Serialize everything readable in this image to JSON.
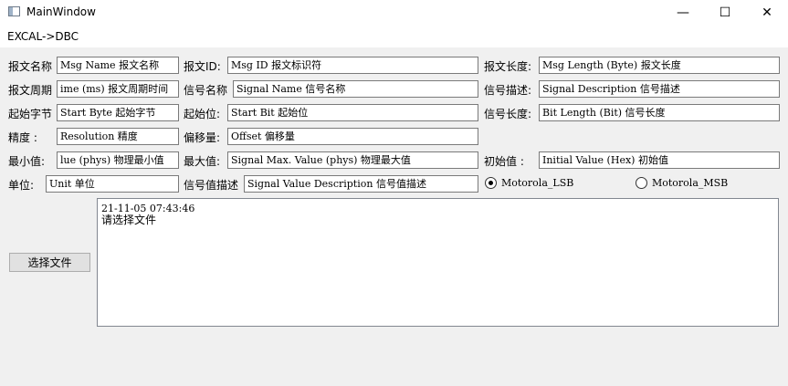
{
  "window": {
    "title": "MainWindow",
    "minimize": "—",
    "maximize": "☐",
    "close": "✕"
  },
  "menu": {
    "item": "EXCAL->DBC"
  },
  "rows": [
    [
      {
        "label": "报文名称",
        "value": "Msg Name 报文名称"
      },
      {
        "label": "报文ID:",
        "value": "Msg ID 报文标识符"
      },
      {
        "label": "报文长度:",
        "value": "Msg Length (Byte) 报文长度"
      }
    ],
    [
      {
        "label": "报文周期",
        "value": "ime (ms) 报文周期时间"
      },
      {
        "label": "信号名称",
        "value": "Signal Name 信号名称"
      },
      {
        "label": "信号描述:",
        "value": "Signal Description 信号描述"
      }
    ],
    [
      {
        "label": "起始字节",
        "value": "Start Byte 起始字节"
      },
      {
        "label": "起始位:",
        "value": "Start Bit 起始位"
      },
      {
        "label": "信号长度:",
        "value": "Bit Length (Bit) 信号长度"
      }
    ],
    [
      {
        "label": "精度  :",
        "value": "Resolution 精度"
      },
      {
        "label": "偏移量:",
        "value": "Offset 偏移量"
      }
    ],
    [
      {
        "label": "最小值:",
        "value": "lue (phys) 物理最小值"
      },
      {
        "label": "最大值:",
        "value": "Signal Max. Value (phys) 物理最大值"
      },
      {
        "label": "初始值  :",
        "value": "Initial Value (Hex) 初始值"
      }
    ],
    [
      {
        "label": "单位:",
        "value": "Unit 单位"
      },
      {
        "label": "信号值描述",
        "value": "Signal Value Description 信号值描述"
      }
    ]
  ],
  "byte_order": {
    "options": [
      "Motorola_LSB",
      "Motorola_MSB"
    ],
    "selected": "Motorola_LSB"
  },
  "select_file_button": "选择文件",
  "log": {
    "timestamp": "21-11-05 07:43:46",
    "message": "请选择文件"
  }
}
